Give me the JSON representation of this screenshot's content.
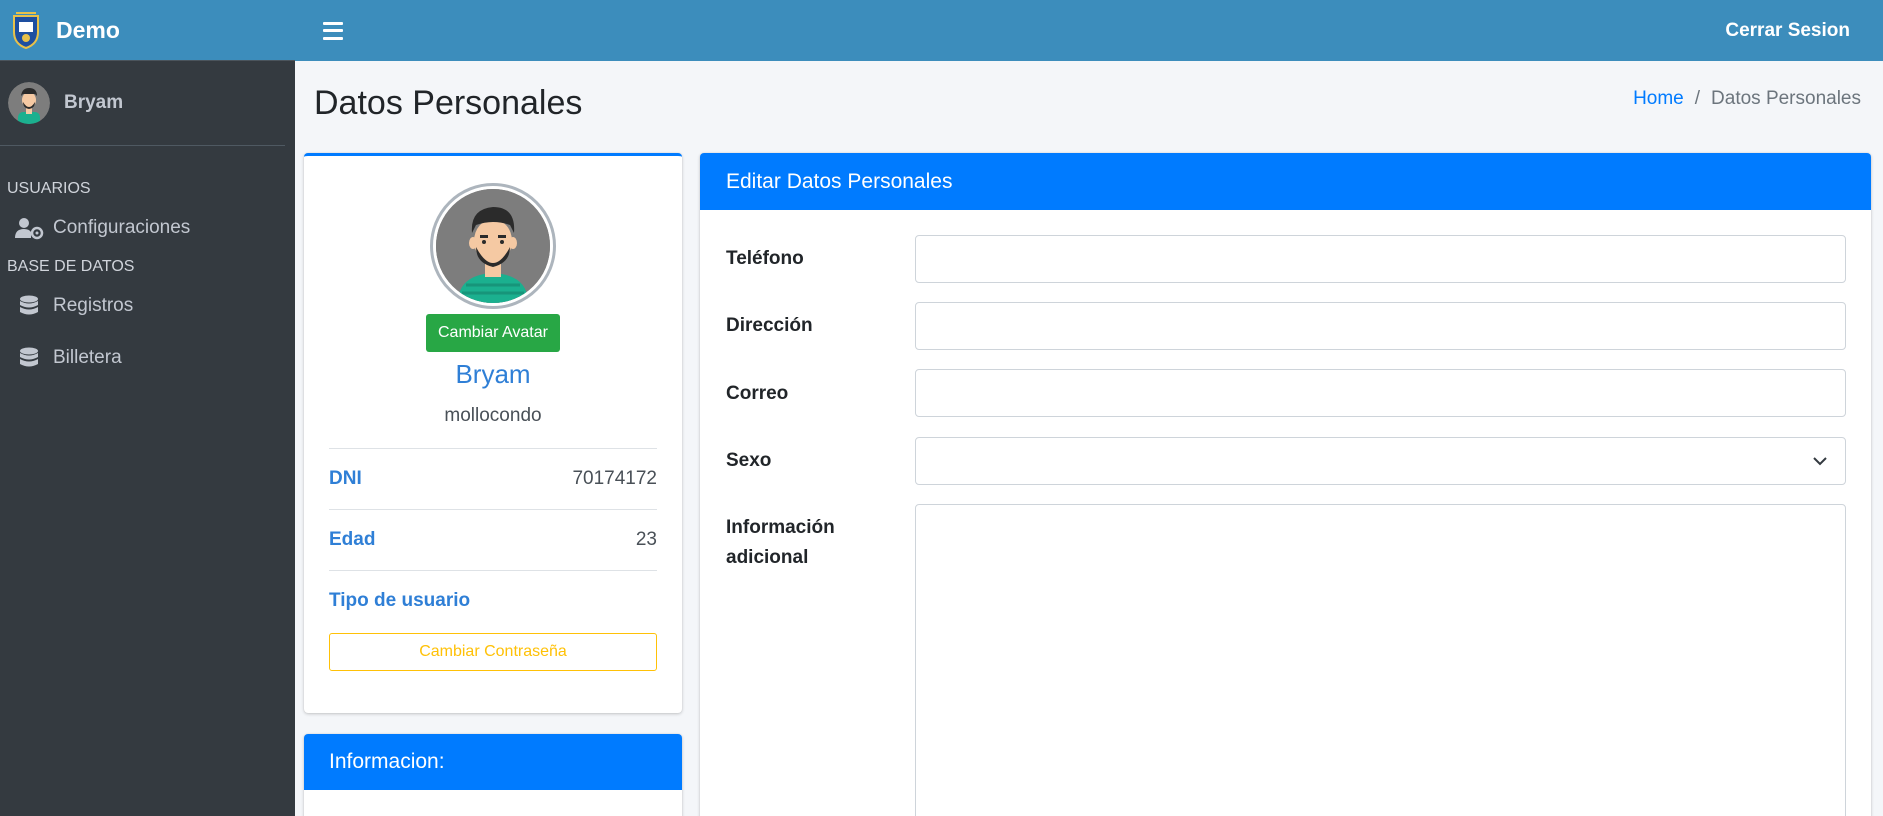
{
  "brand": {
    "name": "Demo",
    "logo_icon": "crest-logo"
  },
  "sidebar": {
    "user_name": "Bryam",
    "sections": [
      {
        "header": "USUARIOS",
        "items": [
          {
            "label": "Configuraciones",
            "icon": "users-cog-icon"
          }
        ]
      },
      {
        "header": "BASE DE DATOS",
        "items": [
          {
            "label": "Registros",
            "icon": "database-icon"
          },
          {
            "label": "Billetera",
            "icon": "database-icon"
          }
        ]
      }
    ]
  },
  "topbar": {
    "menu_icon": "hamburger-icon",
    "logout_label": "Cerrar Sesion"
  },
  "page": {
    "title": "Datos Personales",
    "breadcrumb": {
      "home": "Home",
      "separator": "/",
      "current": "Datos Personales"
    }
  },
  "profile": {
    "change_avatar_label": "Cambiar Avatar",
    "name": "Bryam",
    "username": "mollocondo",
    "rows": [
      {
        "key": "DNI",
        "value": "70174172"
      },
      {
        "key": "Edad",
        "value": "23"
      },
      {
        "key": "Tipo de usuario",
        "value": ""
      }
    ],
    "change_password_label": "Cambiar Contraseña"
  },
  "info_card": {
    "title": "Informacion:"
  },
  "edit_form": {
    "title": "Editar Datos Personales",
    "fields": {
      "telefono": {
        "label": "Teléfono",
        "value": ""
      },
      "direccion": {
        "label": "Dirección",
        "value": ""
      },
      "correo": {
        "label": "Correo",
        "value": ""
      },
      "sexo": {
        "label": "Sexo",
        "value": ""
      },
      "info_line1": "Información",
      "info_line2": "adicional"
    }
  },
  "colors": {
    "navbar": "#3c8dbc",
    "sidebar": "#343a40",
    "primary": "#007bff",
    "success": "#28a745",
    "warning": "#ffc107"
  }
}
